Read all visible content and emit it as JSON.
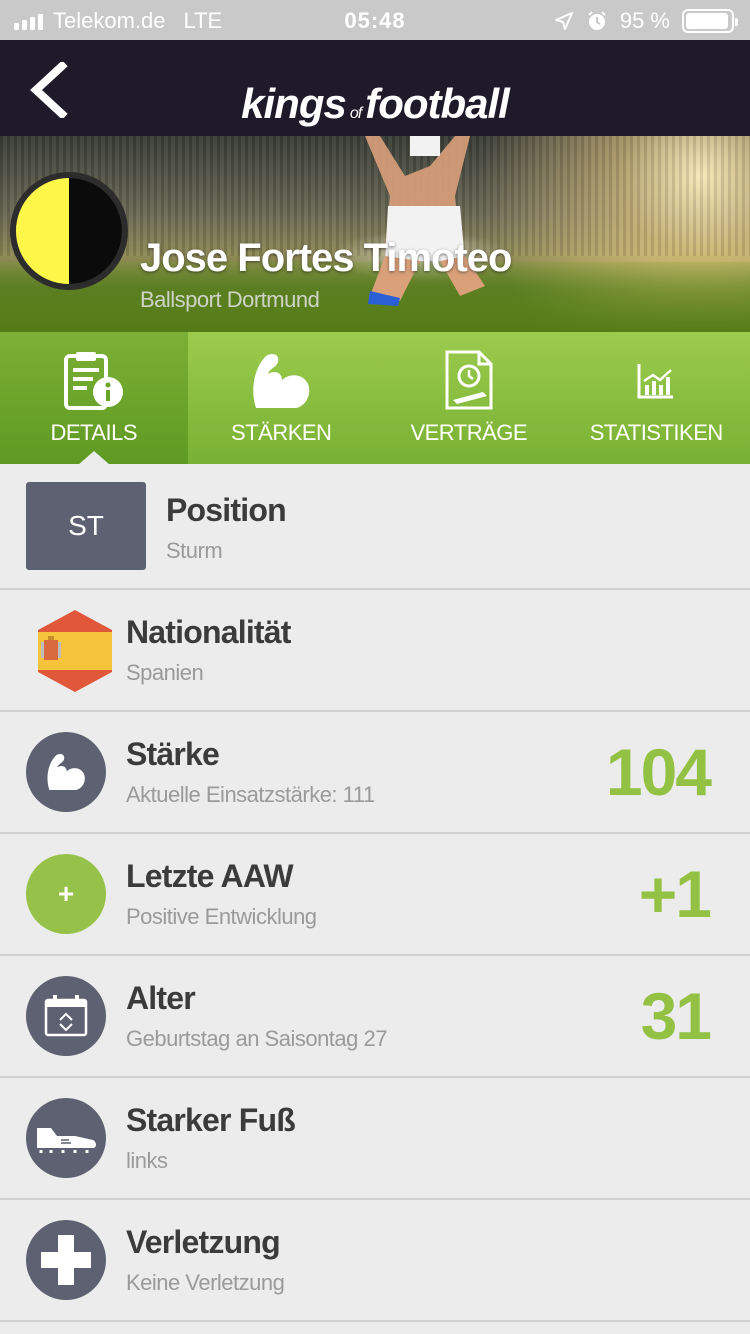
{
  "statusbar": {
    "carrier": "Telekom.de",
    "network": "LTE",
    "time": "05:48",
    "battery_text": "95 %",
    "battery_level": 0.95
  },
  "navbar": {
    "logo_left": "kings",
    "logo_mid": "of",
    "logo_right": "football"
  },
  "hero": {
    "player_name": "Jose Fortes Timoteo",
    "club_name": "Ballsport Dortmund"
  },
  "tabs": [
    {
      "label": "DETAILS",
      "icon": "details-icon",
      "active": true
    },
    {
      "label": "STÄRKEN",
      "icon": "strength-icon",
      "active": false
    },
    {
      "label": "VERTRÄGE",
      "icon": "contract-icon",
      "active": false
    },
    {
      "label": "STATISTIKEN",
      "icon": "statistics-icon",
      "active": false
    }
  ],
  "details": {
    "position": {
      "badge": "ST",
      "title": "Position",
      "sub": "Sturm"
    },
    "nationality": {
      "title": "Nationalität",
      "sub": "Spanien",
      "icon": "spain-flag-icon"
    },
    "strength": {
      "title": "Stärke",
      "sub": "Aktuelle Einsatzstärke: 111",
      "value": "104",
      "icon": "muscle-icon"
    },
    "last_aaw": {
      "title": "Letzte AAW",
      "sub": "Positive Entwicklung",
      "value": "+1",
      "icon_glyph": "+",
      "icon": "plus-icon"
    },
    "age": {
      "title": "Alter",
      "sub": "Geburtstag an Saisontag 27",
      "value": "31",
      "icon": "calendar-icon"
    },
    "foot": {
      "title": "Starker Fuß",
      "sub": "links",
      "icon": "football-boot-icon"
    },
    "injury": {
      "title": "Verletzung",
      "sub": "Keine Verletzung",
      "icon": "medical-cross-icon"
    }
  },
  "colors": {
    "accent_green": "#93c143",
    "nav_dark": "#1e1a2a",
    "icon_gray": "#5e6171",
    "club_yellow": "#fef74a",
    "club_black": "#0b0b0b"
  }
}
